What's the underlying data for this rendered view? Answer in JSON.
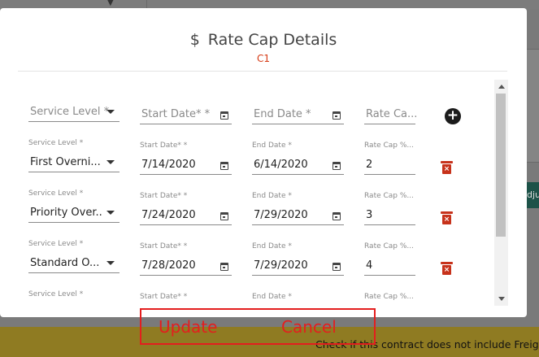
{
  "background": {
    "partial_button_label": "dju",
    "footer_notice": "Check if this contract does not include Freig"
  },
  "modal": {
    "title": "Rate Cap Details",
    "currency_icon": "$",
    "subtitle": "C1"
  },
  "header_row": {
    "service_level_placeholder": "Service Level *",
    "start_date_placeholder": "Start Date* *",
    "end_date_placeholder": "End Date *",
    "rate_cap_placeholder": "Rate Ca...",
    "add_icon": "plus-circle-icon"
  },
  "field_labels": {
    "service_level": "Service Level *",
    "start_date": "Start Date* *",
    "end_date": "End Date *",
    "rate_cap": "Rate Cap %..."
  },
  "rows": [
    {
      "service_level": "First Overni...",
      "start_date": "7/14/2020",
      "end_date": "6/14/2020",
      "rate_cap": "2"
    },
    {
      "service_level": "Priority Over...",
      "start_date": "7/24/2020",
      "end_date": "7/29/2020",
      "rate_cap": "3"
    },
    {
      "service_level": "Standard O...",
      "start_date": "7/28/2020",
      "end_date": "7/29/2020",
      "rate_cap": "4"
    },
    {
      "service_level": "",
      "start_date": "",
      "end_date": "",
      "rate_cap": ""
    }
  ],
  "actions": {
    "update_label": "Update",
    "cancel_label": "Cancel"
  },
  "colors": {
    "accent_red": "#e41e1e",
    "delete_red": "#c7321b",
    "subtitle_red": "#d63a14"
  }
}
